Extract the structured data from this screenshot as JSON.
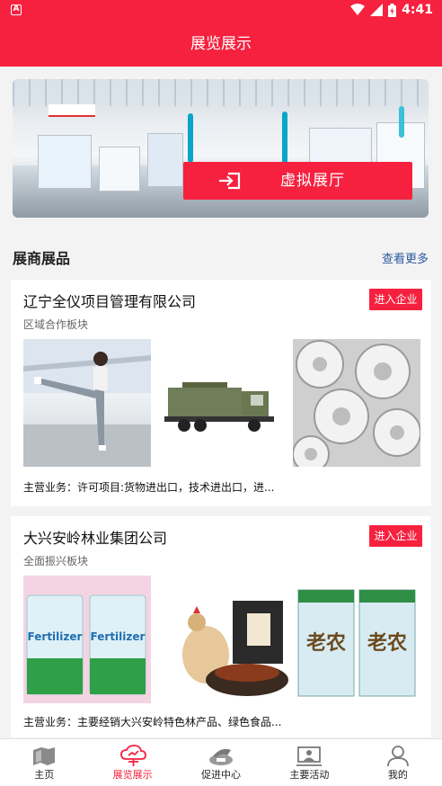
{
  "status_bar": {
    "time": "4:41",
    "app_glyph": "A"
  },
  "header": {
    "title": "展览展示"
  },
  "banner": {
    "button_label": "虚拟展厅",
    "button_icon": "enter-icon"
  },
  "section": {
    "title": "展商展品",
    "more_label": "查看更多"
  },
  "exhibitors": [
    {
      "name": "辽宁全仪项目管理有限公司",
      "enter_label": "进入企业",
      "sector": "区域合作板块",
      "business": "主营业务：许可项目:货物进出口，技术进出口，进...",
      "images": [
        "woman-photo",
        "fire-truck-photo",
        "gears-photo"
      ]
    },
    {
      "name": "大兴安岭林业集团公司",
      "enter_label": "进入企业",
      "sector": "全面振兴板块",
      "business": "主营业务：主要经销大兴安岭特色林产品、绿色食品...",
      "images": [
        "fertilizer-bags-photo",
        "chicken-gift-box-photo",
        "laonong-box-photo"
      ],
      "image_text": {
        "fertilizer": "Fertilizer",
        "laonong": "老农"
      }
    }
  ],
  "tabs": [
    {
      "label": "主页",
      "icon": "home-icon",
      "active": false
    },
    {
      "label": "展览展示",
      "icon": "exhibition-icon",
      "active": true
    },
    {
      "label": "促进中心",
      "icon": "promotion-center-icon",
      "active": false
    },
    {
      "label": "主要活动",
      "icon": "activities-icon",
      "active": false
    },
    {
      "label": "我的",
      "icon": "profile-icon",
      "active": false
    }
  ],
  "colors": {
    "brand_red": "#f6213f",
    "link_blue": "#2c58a0"
  }
}
